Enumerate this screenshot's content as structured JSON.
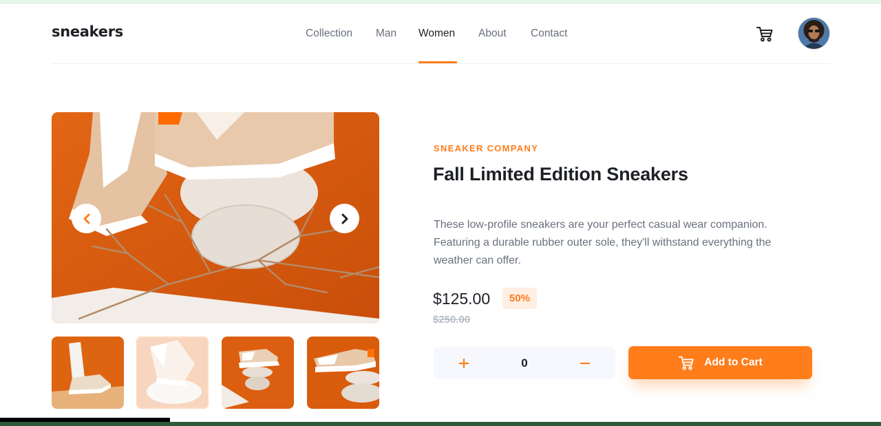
{
  "header": {
    "brand": "sneakers",
    "nav": [
      {
        "label": "Collection",
        "active": false
      },
      {
        "label": "Man",
        "active": false
      },
      {
        "label": "Women",
        "active": true
      },
      {
        "label": "About",
        "active": false
      },
      {
        "label": "Contact",
        "active": false
      }
    ],
    "cart_icon": "cart-icon",
    "avatar_icon": "user-avatar"
  },
  "gallery": {
    "prev_icon": "chevron-left-icon",
    "next_icon": "chevron-right-icon",
    "thumbnails": [
      {
        "name": "thumbnail-1",
        "active": false
      },
      {
        "name": "thumbnail-2",
        "active": true
      },
      {
        "name": "thumbnail-3",
        "active": false
      },
      {
        "name": "thumbnail-4",
        "active": false
      }
    ]
  },
  "product": {
    "company": "SNEAKER COMPANY",
    "title": "Fall Limited Edition Sneakers",
    "description": "These low-profile sneakers are your perfect casual wear companion. Featuring a durable rubber outer sole, they'll withstand everything the weather can offer.",
    "price": "$125.00",
    "discount": "50%",
    "old_price": "$250.00",
    "quantity": "0",
    "plus_label": "+",
    "minus_label": "−",
    "add_to_cart": "Add to Cart"
  },
  "colors": {
    "accent": "#ff7d1a",
    "accent_light": "#ffeee2",
    "dark_text": "#1d2025",
    "muted_text": "#69707d",
    "image_orange": "#dc5b10"
  }
}
